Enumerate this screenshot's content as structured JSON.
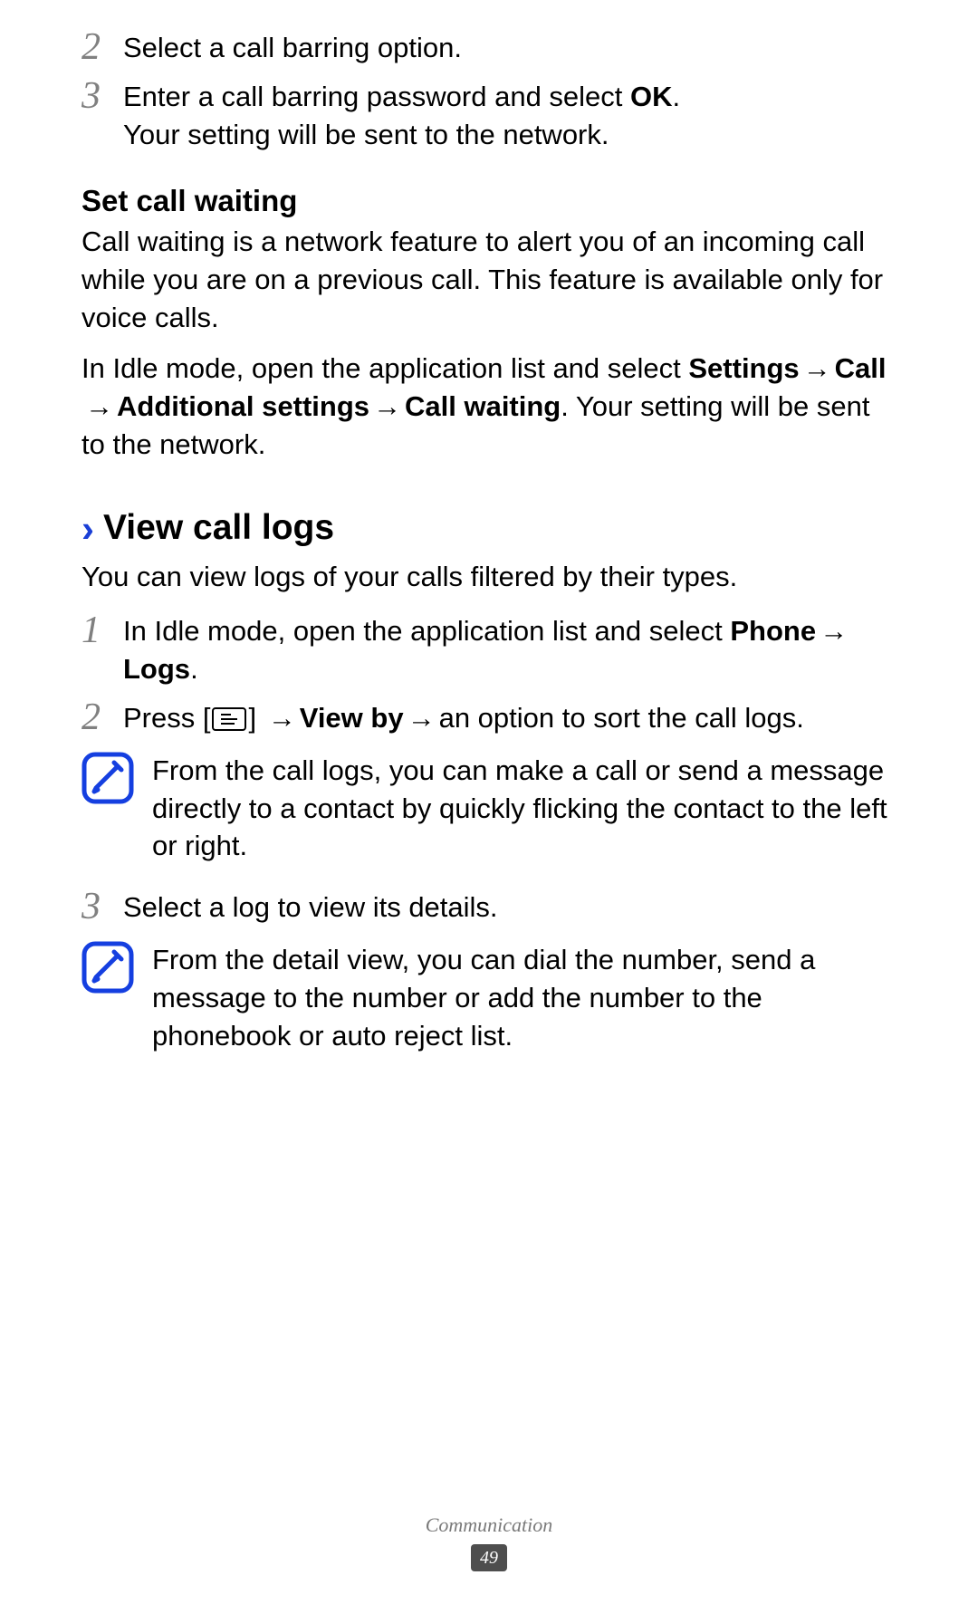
{
  "prev_steps": {
    "s2_num": "2",
    "s2_text": "Select a call barring option.",
    "s3_num": "3",
    "s3_pre": "Enter a call barring password and select ",
    "s3_bold": "OK",
    "s3_post": ".",
    "s3_line2": "Your setting will be sent to the network."
  },
  "call_waiting": {
    "heading": "Set call waiting",
    "para1": "Call waiting is a network feature to alert you of an incoming call while you are on a previous call. This feature is available only for voice calls.",
    "p2_a": "In Idle mode, open the application list and select ",
    "p2_b1": "Settings",
    "arrow": " → ",
    "p2_b2": "Call",
    "p2_b3": "Additional settings",
    "p2_b4": "Call waiting",
    "p2_c": ". Your setting will be sent to the network."
  },
  "logs": {
    "chev": "›",
    "heading": "View call logs",
    "intro": "You can view logs of your calls filtered by their types.",
    "s1_num": "1",
    "s1_a": "In Idle mode, open the application list and select ",
    "s1_b1": "Phone",
    "s1_arrow": " → ",
    "s1_b2": "Logs",
    "s1_c": ".",
    "s2_num": "2",
    "s2_a": "Press [",
    "s2_b": "] ",
    "s2_arrow1": "→ ",
    "s2_bold": "View by",
    "s2_arrow2": " → ",
    "s2_c": "an option to sort the call logs.",
    "note1": "From the call logs, you can make a call or send a message directly to a contact by quickly flicking the contact to the left or right.",
    "s3_num": "3",
    "s3_text": "Select a log to view its details.",
    "note2": "From the detail view, you can dial the number, send a message to the number or add the number to the phonebook or auto reject list."
  },
  "footer": {
    "section": "Communication",
    "page": "49"
  }
}
